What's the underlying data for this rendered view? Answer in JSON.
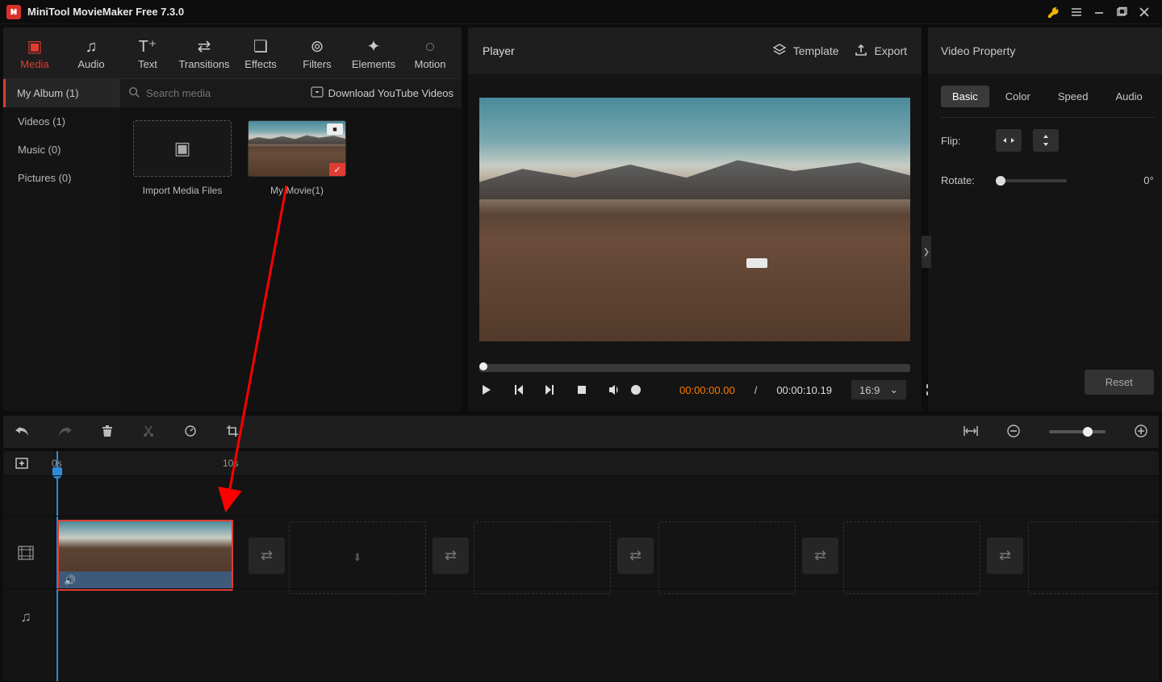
{
  "titlebar": {
    "title": "MiniTool MovieMaker Free 7.3.0"
  },
  "top_tabs": {
    "media": "Media",
    "audio": "Audio",
    "text": "Text",
    "transitions": "Transitions",
    "effects": "Effects",
    "filters": "Filters",
    "elements": "Elements",
    "motion": "Motion"
  },
  "album": {
    "my_album": "My Album (1)",
    "videos": "Videos (1)",
    "music": "Music (0)",
    "pictures": "Pictures (0)"
  },
  "media": {
    "search_placeholder": "Search media",
    "download": "Download YouTube Videos",
    "import_label": "Import Media Files",
    "clip1_label": "My Movie(1)"
  },
  "player": {
    "title": "Player",
    "template": "Template",
    "export": "Export",
    "cur_time": "00:00:00.00",
    "sep": " / ",
    "total_time": "00:00:10.19",
    "aspect": "16:9"
  },
  "props": {
    "panel_title": "Video Property",
    "tabs": {
      "basic": "Basic",
      "color": "Color",
      "speed": "Speed",
      "audio": "Audio"
    },
    "flip_label": "Flip:",
    "rotate_label": "Rotate:",
    "rotate_value": "0°",
    "reset": "Reset"
  },
  "ruler": {
    "t0": "0s",
    "t10": "10s"
  }
}
